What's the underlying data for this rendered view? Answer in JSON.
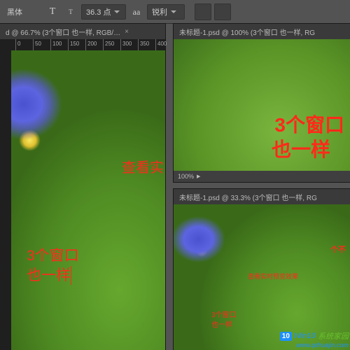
{
  "toolbar": {
    "font_family": "黑体",
    "type_icon_big": "T",
    "type_icon_small": "T",
    "font_size": "36.3 点",
    "aa_label": "aa",
    "antialias": "锐利"
  },
  "panels": {
    "left": {
      "tab_title": "d @ 66.7% (3个窗口 也一样, RGB/…",
      "ruler_labels": [
        "0",
        "50",
        "100",
        "150",
        "200",
        "250",
        "300",
        "350",
        "400"
      ],
      "annotations": {
        "view_text": "查看实",
        "main_line1": "3个窗口",
        "main_line2": "也一样"
      }
    },
    "topright": {
      "tab_title": "未标题-1.psd @ 100% (3个窗口 也一样, RG",
      "zoom": "100%",
      "annotations": {
        "main_line1": "3个窗口",
        "main_line2": "也一样"
      }
    },
    "botright": {
      "tab_title": "未标题-1.psd @ 33.3% (3个窗口 也一样, RG",
      "annotations": {
        "corner": "个不",
        "view_text": "查看实时预览效果",
        "main_line1": "3个窗口",
        "main_line2": "也一样"
      }
    }
  },
  "watermark": {
    "badge": "10",
    "blue": "Win10",
    "green": "系统家园",
    "url": "www.qdhuajin.com"
  }
}
